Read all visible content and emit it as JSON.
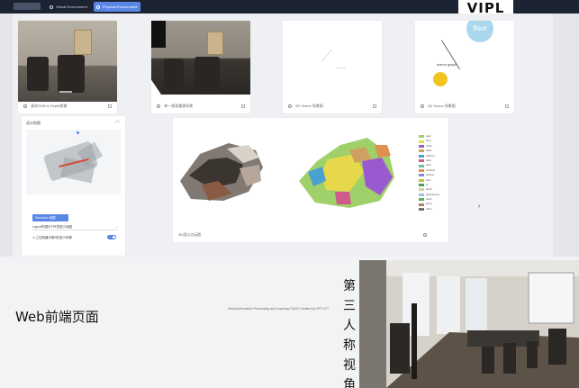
{
  "topbar": {
    "tabs": [
      {
        "label": "Virtual Environment",
        "active": false
      },
      {
        "label": "Physical Environment",
        "active": true
      }
    ],
    "brand_badge": "VIPL"
  },
  "cards": [
    {
      "footer_label": "真实RGB & Depth图像",
      "thumb": "room-photo"
    },
    {
      "footer_label": "单一视角重建场景",
      "thumb": "room-photo-reconstruction"
    },
    {
      "footer_label": "2D Scene 场景图",
      "thumb": "blank"
    },
    {
      "footer_label": "3D Scene 场景图",
      "thumb": "bubble-chart"
    }
  ],
  "bubble_chart": {
    "big_node_label": "floor",
    "small_node_label": "scene graph"
  },
  "map_panel": {
    "title": "语义地图",
    "button_label": "Semantic 地图",
    "rows": [
      {
        "label": "Layout所属8个环境语义地图"
      },
      {
        "label": "人工控制器中断3的语义转移"
      }
    ]
  },
  "pointcloud_panel": {
    "footer_label": "3D语义点云图",
    "legend": [
      {
        "label": "wall",
        "color": "#9fd06a"
      },
      {
        "label": "floor",
        "color": "#e6d84a"
      },
      {
        "label": "chair",
        "color": "#9b59d0"
      },
      {
        "label": "table",
        "color": "#d0a060"
      },
      {
        "label": "cabinet",
        "color": "#4aa0d0"
      },
      {
        "label": "sofa",
        "color": "#d05a8a"
      },
      {
        "label": "door",
        "color": "#6ac0a0"
      },
      {
        "label": "window",
        "color": "#e09050"
      },
      {
        "label": "picture",
        "color": "#8a8ad0"
      },
      {
        "label": "bed",
        "color": "#c0c040"
      },
      {
        "label": "tv",
        "color": "#50a050"
      },
      {
        "label": "shelf",
        "color": "#d0d0a0"
      },
      {
        "label": "whiteboard",
        "color": "#a0c0e0"
      },
      {
        "label": "plant",
        "color": "#60b060"
      },
      {
        "label": "lamp",
        "color": "#b08060"
      },
      {
        "label": "other",
        "color": "#707070"
      }
    ]
  },
  "footer": {
    "title": "Web前端页面",
    "credit": "Visual Information Processing and Learning ©2022 Created by VIPL ICT",
    "side_caption": [
      "第",
      "三",
      "人",
      "称",
      "视",
      "角"
    ]
  }
}
